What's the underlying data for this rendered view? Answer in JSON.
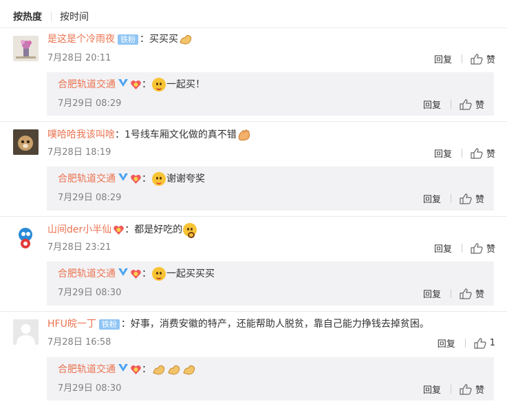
{
  "tabs": {
    "hot": "按热度",
    "time": "按时间"
  },
  "labels": {
    "reply": "回复",
    "like": "赞"
  },
  "colors": {
    "username": "#eb7350",
    "badge": "#8fc5f4",
    "reply_bg": "#f2f2f5",
    "verified": "#f9b43a"
  },
  "comments": [
    {
      "user": "是这是个冷雨夜",
      "badge": "铁粉",
      "text": "：买买买",
      "emojis": [
        "muscle-emoji"
      ],
      "time": "7月28日 20:11",
      "like": "赞",
      "reply": {
        "user": "合肥轨道交通",
        "text": "一起买！",
        "emojis": [
          "smile-emoji"
        ],
        "time": "7月29日 08:29",
        "like": "赞"
      }
    },
    {
      "user": "噗哈哈我该叫啥",
      "text": "：1号线车厢文化做的真不错",
      "emojis": [
        "clap-emoji"
      ],
      "time": "7月28日 18:19",
      "like": "赞",
      "reply": {
        "user": "合肥轨道交通",
        "text": "谢谢夸奖",
        "emojis": [
          "tongue-emoji"
        ],
        "time": "7月29日 08:29",
        "like": "赞"
      }
    },
    {
      "user": "山间der小半仙",
      "text": "：都是好吃的",
      "emojis": [
        "shocked-emoji"
      ],
      "time": "7月28日 23:21",
      "like": "赞",
      "reply": {
        "user": "合肥轨道交通",
        "text": "一起买买买",
        "emojis": [
          "smile-emoji"
        ],
        "time": "7月29日 08:30",
        "like": "赞"
      }
    },
    {
      "user": "HFU皖一丁",
      "badge": "铁粉",
      "text": "：好事，消费安徽的特产，还能帮助人脱贫，靠自己能力挣钱去掉贫困。",
      "time": "7月28日 16:58",
      "like": "1",
      "reply": {
        "user": "合肥轨道交通",
        "text": "",
        "emojis": [
          "muscle-emoji",
          "muscle-emoji",
          "muscle-emoji"
        ],
        "time": "7月29日 08:30",
        "like": "赞"
      }
    }
  ]
}
